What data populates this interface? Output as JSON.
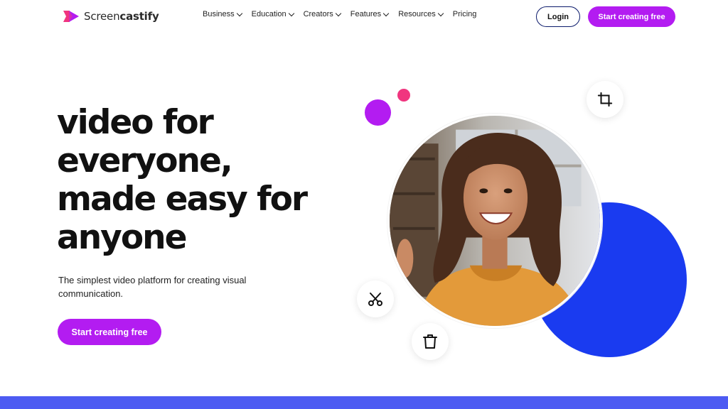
{
  "brand": {
    "name_light": "Screen",
    "name_bold": "castify",
    "logo_icon": "play-arrow-logo-icon",
    "accent": "#b31cf1",
    "pink": "#f0357f",
    "blue": "#1a3bf0"
  },
  "nav": {
    "items": [
      {
        "label": "Business",
        "has_dropdown": true
      },
      {
        "label": "Education",
        "has_dropdown": true
      },
      {
        "label": "Creators",
        "has_dropdown": true
      },
      {
        "label": "Features",
        "has_dropdown": true
      },
      {
        "label": "Resources",
        "has_dropdown": true
      },
      {
        "label": "Pricing",
        "has_dropdown": false
      }
    ],
    "login_label": "Login",
    "cta_label": "Start creating free"
  },
  "hero": {
    "title_lines": [
      "video for",
      "everyone,",
      "made easy for",
      "anyone"
    ],
    "subtitle": "The simplest video platform for creating visual communication.",
    "cta_label": "Start creating free"
  },
  "illustration": {
    "tools": [
      "crop-icon",
      "scissors-icon",
      "trash-icon"
    ]
  }
}
